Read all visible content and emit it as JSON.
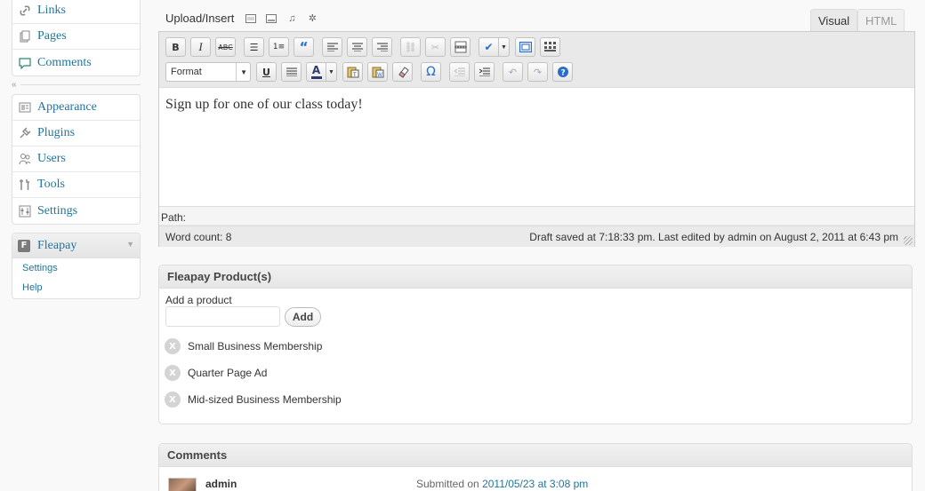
{
  "sidebar": {
    "top_items": [
      {
        "label": "Links",
        "icon": "link-icon"
      },
      {
        "label": "Pages",
        "icon": "pages-icon"
      },
      {
        "label": "Comments",
        "icon": "comments-icon"
      }
    ],
    "mid_items": [
      {
        "label": "Appearance",
        "icon": "appearance-icon"
      },
      {
        "label": "Plugins",
        "icon": "plugins-icon"
      },
      {
        "label": "Users",
        "icon": "users-icon"
      },
      {
        "label": "Tools",
        "icon": "tools-icon"
      },
      {
        "label": "Settings",
        "icon": "settings-icon"
      }
    ],
    "fleapay": {
      "badge": "F",
      "label": "Fleapay",
      "sub_items": [
        "Settings",
        "Help"
      ]
    }
  },
  "editor": {
    "upload_label": "Upload/Insert",
    "tabs": {
      "visual": "Visual",
      "html": "HTML"
    },
    "format_label": "Format",
    "content": "Sign up for one of our class today!",
    "path_label": "Path:",
    "word_count": "Word count: 8",
    "draft_status": "Draft saved at 7:18:33 pm. Last edited by admin on August 2, 2011 at 6:43 pm"
  },
  "products_box": {
    "title": "Fleapay Product(s)",
    "add_label": "Add a product",
    "add_button": "Add",
    "input_value": "",
    "products": [
      "Small Business Membership",
      "Quarter Page Ad",
      "Mid-sized Business Membership"
    ],
    "remove_glyph": "X"
  },
  "comments_box": {
    "title": "Comments",
    "author": "admin",
    "submitted_prefix": "Submitted on",
    "submitted_link": "2011/05/23 at 3:08 pm"
  },
  "colors": {
    "link": "#21759b",
    "accent": "#2a6bd0"
  }
}
